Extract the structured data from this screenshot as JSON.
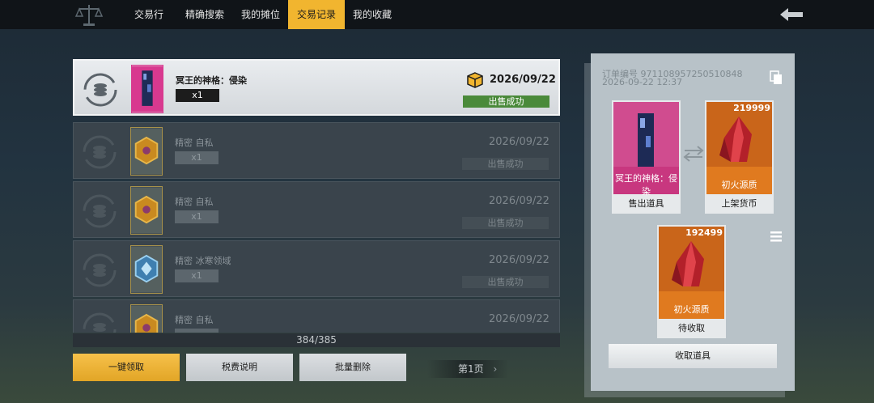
{
  "nav": {
    "tabs": [
      {
        "label": "交易行",
        "active": false
      },
      {
        "label": "精确搜索",
        "active": false
      },
      {
        "label": "我的摊位",
        "active": false
      },
      {
        "label": "交易记录",
        "active": true
      },
      {
        "label": "我的收藏",
        "active": false
      }
    ],
    "back_icon": "back-arrow-icon",
    "logo_icon": "scales-icon"
  },
  "records": [
    {
      "name": "冥王的神格：侵染",
      "qty": "x1",
      "date": "2026/09/22",
      "status": "出售成功",
      "thumb": "pillar-pink",
      "selected": true
    },
    {
      "name": "精密 自私",
      "qty": "x1",
      "date": "2026/09/22",
      "status": "出售成功",
      "thumb": "gold-hex",
      "selected": false
    },
    {
      "name": "精密 自私",
      "qty": "x1",
      "date": "2026/09/22",
      "status": "出售成功",
      "thumb": "gold-hex",
      "selected": false
    },
    {
      "name": "精密 冰寒领域",
      "qty": "x1",
      "date": "2026/09/22",
      "status": "出售成功",
      "thumb": "blue-hex",
      "selected": false
    },
    {
      "name": "精密 自私",
      "qty": "",
      "date": "2026/09/22",
      "status": "",
      "thumb": "gold-hex",
      "selected": false
    }
  ],
  "record_count": "384/385",
  "buttons": {
    "claim_all": "一键领取",
    "tax_info": "税费说明",
    "batch_delete": "批量删除",
    "page": "第1页"
  },
  "detail": {
    "order_no": "订单编号 971108957250510848",
    "order_time": "2026-09-22 12:37",
    "sold_item": {
      "label": "冥王的神格：侵染",
      "caption": "售出道具"
    },
    "listed_currency": {
      "label": "初火源质",
      "amount": "219999",
      "caption": "上架货币"
    },
    "pending": {
      "label": "初火源质",
      "amount": "192499",
      "caption": "待收取"
    },
    "claim_button": "收取道具"
  },
  "colors": {
    "accent": "#f1b52f",
    "success": "#4a8a3a",
    "item_pink": "#d8398f",
    "item_orange": "#e07a1f"
  }
}
